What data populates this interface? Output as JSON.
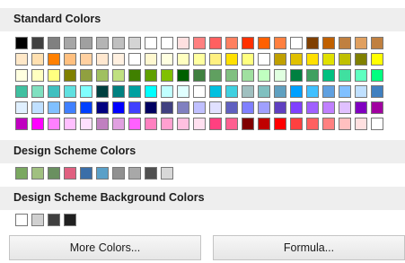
{
  "sections": {
    "standard": {
      "title": "Standard Colors"
    },
    "scheme": {
      "title": "Design Scheme Colors"
    },
    "scheme_bg": {
      "title": "Design Scheme Background Colors"
    }
  },
  "standard_colors": [
    [
      "#000000",
      "#404040",
      "#808080",
      "#a6a6a6",
      "#a0a0a0",
      "#b4b4b4",
      "#c0c0c0",
      "#d4d4d4",
      "#ffffff",
      "#ffffff",
      "#ffe0e0",
      "#ff8080",
      "#ff6060",
      "#ff8060",
      "#ff3000",
      "#ff6000",
      "#ff8040",
      "#ffffff",
      "#804000",
      "#c06000",
      "#c08040",
      "#e0a060",
      "#c08040"
    ],
    [
      "#ffe8c8",
      "#ffe0b0",
      "#ff8000",
      "#ffc080",
      "#ffd0a0",
      "#ffe8d0",
      "#fff0e0",
      "#ffffff",
      "#fff8d0",
      "#ffffe0",
      "#ffffc0",
      "#ffffa0",
      "#fff080",
      "#ffe000",
      "#ffff80",
      "#ffffff",
      "#c0a000",
      "#e0c000",
      "#ffe000",
      "#e0e000",
      "#c0c000",
      "#808000",
      "#ffff00"
    ],
    [
      "#ffffe0",
      "#ffffc0",
      "#ffff80",
      "#808000",
      "#90a040",
      "#a0c060",
      "#c0e080",
      "#408000",
      "#60a000",
      "#80c000",
      "#006000",
      "#408040",
      "#60a060",
      "#80c080",
      "#a0e0a0",
      "#c0ffc0",
      "#e0ffe0",
      "#008040",
      "#40a060",
      "#00c080",
      "#40e0a0",
      "#60ffc0",
      "#00ff80"
    ],
    [
      "#40c0a0",
      "#80e0c0",
      "#40c0c0",
      "#60e0e0",
      "#80ffff",
      "#004040",
      "#008080",
      "#00a0a0",
      "#00ffff",
      "#c0ffff",
      "#e0ffff",
      "#ffffff",
      "#00c0e0",
      "#40d0e0",
      "#a0c0c0",
      "#80c0c0",
      "#60a0c0",
      "#00a0ff",
      "#40c0ff",
      "#60a0e0",
      "#80c0ff",
      "#c0e0ff",
      "#4080c0"
    ],
    [
      "#e0f0ff",
      "#c0e0ff",
      "#80c0ff",
      "#4080ff",
      "#0040ff",
      "#000080",
      "#0000ff",
      "#4040ff",
      "#000060",
      "#404080",
      "#8080c0",
      "#c0c0ff",
      "#e0e0ff",
      "#6060c0",
      "#8080ff",
      "#a0a0ff",
      "#6040c0",
      "#8040ff",
      "#a060ff",
      "#c080ff",
      "#e0c0ff",
      "#8000c0",
      "#a000a0"
    ],
    [
      "#c000c0",
      "#ff00ff",
      "#ff80ff",
      "#ffc0ff",
      "#ffe0ff",
      "#c080c0",
      "#e0a0e0",
      "#ff60ff",
      "#ff80c0",
      "#ffa0d0",
      "#ffc0e0",
      "#ffe0f0",
      "#ff4080",
      "#ff6090",
      "#800000",
      "#c00000",
      "#ff0000",
      "#ff4040",
      "#ff6060",
      "#ff8080",
      "#ffc0c0",
      "#ffe0e0",
      "#ffffff"
    ]
  ],
  "scheme_colors": [
    "#7aa860",
    "#a0c080",
    "#6a9060",
    "#e06080",
    "#3a6ea8",
    "#5aa0c8",
    "#909090",
    "#a8a8a8",
    "#505050",
    "#d8d8d8"
  ],
  "scheme_bg_colors": [
    "#ffffff",
    "#d0d0d0",
    "#404040",
    "#202020"
  ],
  "buttons": {
    "more_colors": "More Colors...",
    "formula": "Formula..."
  }
}
